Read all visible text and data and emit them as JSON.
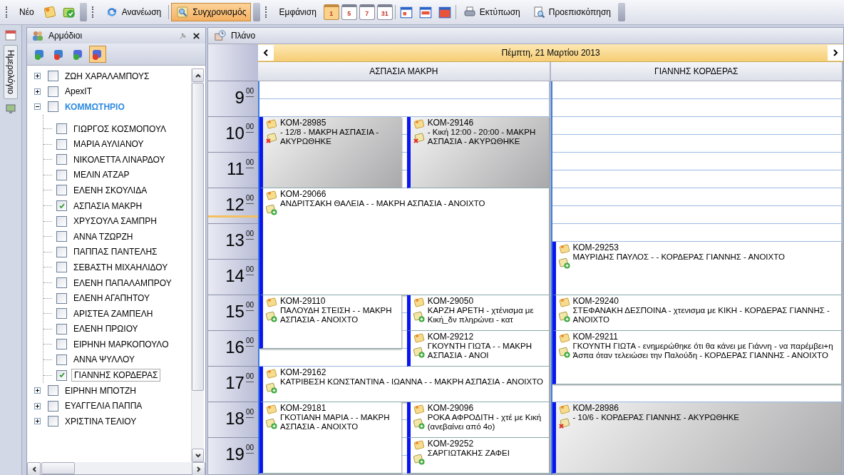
{
  "toolbar": {
    "new_label": "Νέο",
    "refresh_label": "Ανανέωση",
    "sync": {
      "label": "Συγχρονισμός",
      "selected": true
    },
    "view_label": "Εμφάνιση",
    "views": [
      {
        "label": "1",
        "selected": true
      },
      {
        "label": "5",
        "selected": false
      },
      {
        "label": "7",
        "selected": false
      },
      {
        "label": "31",
        "selected": false
      }
    ],
    "print_label": "Εκτύπωση",
    "preview_label": "Προεπισκόπηση"
  },
  "side_tab": {
    "label": "Ημερολόγιο"
  },
  "panel": {
    "title": "Αρμόδιοι",
    "tools": [
      {
        "selected": false
      },
      {
        "selected": false
      },
      {
        "selected": false
      },
      {
        "selected": true
      }
    ],
    "tree": [
      {
        "label": "ΖΩΗ ΧΑΡΑΛΑΜΠΟΥΣ",
        "checked": false,
        "expanded": false
      },
      {
        "label": "ApexIT",
        "checked": false,
        "expanded": false
      },
      {
        "label": "ΚΟΜΜΩΤΗΡΙΟ",
        "checked": false,
        "expanded": true,
        "children": [
          {
            "label": "ΓΙΩΡΓΟΣ ΚΟΣΜΟΠΟΥΛ",
            "checked": false,
            "selected": false
          },
          {
            "label": "ΜΑΡΙΑ ΑΥΛΙΑΝΟΥ",
            "checked": false,
            "selected": false
          },
          {
            "label": "ΝΙΚΟΛΕΤΤΑ ΛΙΝΑΡΔΟΥ",
            "checked": false,
            "selected": false
          },
          {
            "label": "ΜΕΛΙΝ ΑΤΖΑΡ",
            "checked": false,
            "selected": false
          },
          {
            "label": "ΕΛΕΝΗ ΣΚΟΥΛΙΔΑ",
            "checked": false,
            "selected": false
          },
          {
            "label": "ΑΣΠΑΣΙΑ ΜΑΚΡΗ",
            "checked": true,
            "selected": false
          },
          {
            "label": "ΧΡΥΣΟΥΛΑ ΣΑΜΠΡΗ",
            "checked": false,
            "selected": false
          },
          {
            "label": "ΑΝΝΑ ΤΖΩΡΖΗ",
            "checked": false,
            "selected": false
          },
          {
            "label": "ΠΑΠΠΑΣ ΠΑΝΤΕΛΗΣ",
            "checked": false,
            "selected": false
          },
          {
            "label": "ΣΕΒΑΣΤΗ ΜΙΧΑΗΛΙΔΟΥ",
            "checked": false,
            "selected": false
          },
          {
            "label": "ΕΛΕΝΗ ΠΑΠΑΛΑΜΠΡΟΥ",
            "checked": false,
            "selected": false
          },
          {
            "label": "ΕΛΕΝΗ ΑΓΑΠΗΤΟΥ",
            "checked": false,
            "selected": false
          },
          {
            "label": "ΑΡΙΣΤΕΑ ΖΑΜΠΕΛΗ",
            "checked": false,
            "selected": false
          },
          {
            "label": "ΕΛΕΝΗ ΠΡΩΙΟΥ",
            "checked": false,
            "selected": false
          },
          {
            "label": "ΕΙΡΗΝΗ ΜΑΡΚΟΠΟΥΛΟ",
            "checked": false,
            "selected": false
          },
          {
            "label": "ΑΝΝΑ ΨΥΛΛΟΥ",
            "checked": false,
            "selected": false
          },
          {
            "label": "ΓΙΑΝΝΗΣ ΚΟΡΔΕΡΑΣ",
            "checked": true,
            "selected": true
          }
        ]
      },
      {
        "label": "ΕΙΡΗΝΗ ΜΠΟΤΖΗ",
        "checked": false,
        "expanded": false
      },
      {
        "label": "ΕΥΑΓΓΕΛΙΑ ΠΑΠΠΑ",
        "checked": false,
        "expanded": false
      },
      {
        "label": "ΧΡΙΣΤΙΝΑ ΤΕΛΙΟΥ",
        "checked": false,
        "expanded": false
      }
    ]
  },
  "plan": {
    "title": "Πλάνο",
    "date": "Πέμπτη, 21 Μαρτίου 2013",
    "hours": [
      {
        "hour": "9",
        "minutes": "00",
        "current": false
      },
      {
        "hour": "10",
        "minutes": "00",
        "current": false
      },
      {
        "hour": "11",
        "minutes": "00",
        "current": false
      },
      {
        "hour": "12",
        "minutes": "00",
        "current": true
      },
      {
        "hour": "13",
        "minutes": "00",
        "current": false
      },
      {
        "hour": "14",
        "minutes": "00",
        "current": false
      },
      {
        "hour": "15",
        "minutes": "00",
        "current": false
      },
      {
        "hour": "16",
        "minutes": "00",
        "current": false
      },
      {
        "hour": "17",
        "minutes": "00",
        "current": false
      },
      {
        "hour": "18",
        "minutes": "00",
        "current": false
      },
      {
        "hour": "19",
        "minutes": "00",
        "current": false
      }
    ],
    "resources": [
      {
        "name": "ΑΣΠΑΣΙΑ ΜΑΚΡΗ",
        "bands": [
          {
            "kind": "one"
          },
          {
            "kind": "two",
            "lanes": [
              {
                "appointments": [
                  {
                    "code": "ΚΟΜ-28985",
                    "text": "- 12/8 - ΜΑΚΡΗ ΑΣΠΑΣΙΑ - ΑΚΥΡΩΘΗΚΕ",
                    "cancelled": true,
                    "kind": "two"
                  }
                ]
              },
              {
                "appointments": [
                  {
                    "code": "ΚΟΜ-29146",
                    "text": "- Κική 12:00 - 20:00 - ΜΑΚΡΗ ΑΣΠΑΣΙΑ - ΑΚΥΡΩΘΗΚΕ",
                    "cancelled": true,
                    "kind": "two"
                  }
                ]
              }
            ]
          },
          {
            "kind": "three",
            "lanes": [
              {
                "appointments": [
                  {
                    "code": "ΚΟΜ-29066",
                    "text": "ΑΝΔΡΙΤΣΑΚΗ ΘΑΛΕΙΑ - - ΜΑΚΡΗ ΑΣΠΑΣΙΑ - ΑΝΟΙΧΤΟ",
                    "cancelled": false,
                    "kind": "three"
                  }
                ]
              }
            ]
          },
          {
            "kind": "two",
            "lanes": [
              {
                "appointments": [
                  {
                    "code": "ΚΟΜ-29110",
                    "text": "ΠΑΛΟΥΔΗ ΣΤΕΙΣΗ - - ΜΑΚΡΗ ΑΣΠΑΣΙΑ - ΑΝΟΙΧΤΟ",
                    "cancelled": false,
                    "kind": "oneandhalf"
                  }
                ]
              },
              {
                "appointments": [
                  {
                    "code": "ΚΟΜ-29050",
                    "text": "ΚΑΡΖΗ ΑΡΕΤΗ - χτένισμα με Κική_δν πληρώνει - κατ",
                    "cancelled": false,
                    "kind": "one"
                  },
                  {
                    "code": "ΚΟΜ-29212",
                    "text": "ΓΚΟΥΝΤΗ ΓΙΩΤΑ - - ΜΑΚΡΗ ΑΣΠΑΣΙΑ - ΑΝΟΙ",
                    "cancelled": false,
                    "kind": "one"
                  }
                ]
              }
            ]
          },
          {
            "kind": "one",
            "lanes": [
              {
                "appointments": [
                  {
                    "code": "ΚΟΜ-29162",
                    "text": "ΚΑΤΡΙΒΕΣΗ ΚΩΝΣΤΑΝΤΙΝΑ - ΙΩΑΝΝΑ - - ΜΑΚΡΗ ΑΣΠΑΣΙΑ - ΑΝΟΙΧΤΟ",
                    "cancelled": false,
                    "kind": "one"
                  }
                ]
              }
            ]
          },
          {
            "kind": "two",
            "lanes": [
              {
                "appointments": [
                  {
                    "code": "ΚΟΜ-29181",
                    "text": "ΓΚΟΤΙΑΝΗ ΜΑΡΙΑ - - ΜΑΚΡΗ ΑΣΠΑΣΙΑ - ΑΝΟΙΧΤΟ",
                    "cancelled": false,
                    "kind": "two"
                  }
                ]
              },
              {
                "appointments": [
                  {
                    "code": "ΚΟΜ-29096",
                    "text": "ΡΟΚΑ ΑΦΡΟΔΙΤΗ - χτέ με Κική (ανεβαίνει από 4ο)",
                    "cancelled": false,
                    "kind": "one"
                  },
                  {
                    "code": "ΚΟΜ-29252",
                    "text": "ΣΑΡΓΙΩΤΑΚΗΣ ΖΑΦΕΙ",
                    "cancelled": false,
                    "kind": "one"
                  }
                ]
              }
            ]
          }
        ]
      },
      {
        "name": "ΓΙΑΝΝΗΣ ΚΟΡΔΕΡΑΣ",
        "bands": [
          {
            "kind": "fourandhalf"
          },
          {
            "kind": "oneandhalf",
            "lanes": [
              {
                "appointments": [
                  {
                    "code": "ΚΟΜ-29253",
                    "text": "ΜΑΥΡΙΔΗΣ ΠΑΥΛΟΣ - - ΚΟΡΔΕΡΑΣ ΓΙΑΝΝΗΣ - ΑΝΟΙΧΤΟ",
                    "cancelled": false,
                    "kind": "oneandhalf"
                  }
                ]
              }
            ]
          },
          {
            "kind": "one",
            "lanes": [
              {
                "appointments": [
                  {
                    "code": "ΚΟΜ-29240",
                    "text": "ΣΤΕΦΑΝΑΚΗ ΔΕΣΠΟΙΝΑ - χτενισμα με ΚΙΚΗ - ΚΟΡΔΕΡΑΣ ΓΙΑΝΝΗΣ - ΑΝΟΙΧΤΟ",
                    "cancelled": false,
                    "kind": "one"
                  }
                ]
              }
            ]
          },
          {
            "kind": "oneandhalf",
            "lanes": [
              {
                "appointments": [
                  {
                    "code": "ΚΟΜ-29211",
                    "text": "ΓΚΟΥΝΤΗ ΓΙΩΤΑ - ενημερώθηκε ότι θα κάνει με Γιάννη - να παρέμβει+η Άσπα όταν τελειώσει την Παλούδη - ΚΟΡΔΕΡΑΣ ΓΙΑΝΝΗΣ - ΑΝΟΙΧΤΟ",
                    "cancelled": false,
                    "kind": "oneandhalf"
                  }
                ]
              }
            ]
          },
          {
            "kind": "half"
          },
          {
            "kind": "two",
            "lanes": [
              {
                "appointments": [
                  {
                    "code": "ΚΟΜ-28986",
                    "text": "- 10/6 - ΚΟΡΔΕΡΑΣ ΓΙΑΝΝΗΣ - ΑΚΥΡΩΘΗΚΕ",
                    "cancelled": true,
                    "kind": "two"
                  }
                ]
              }
            ]
          }
        ]
      }
    ]
  }
}
